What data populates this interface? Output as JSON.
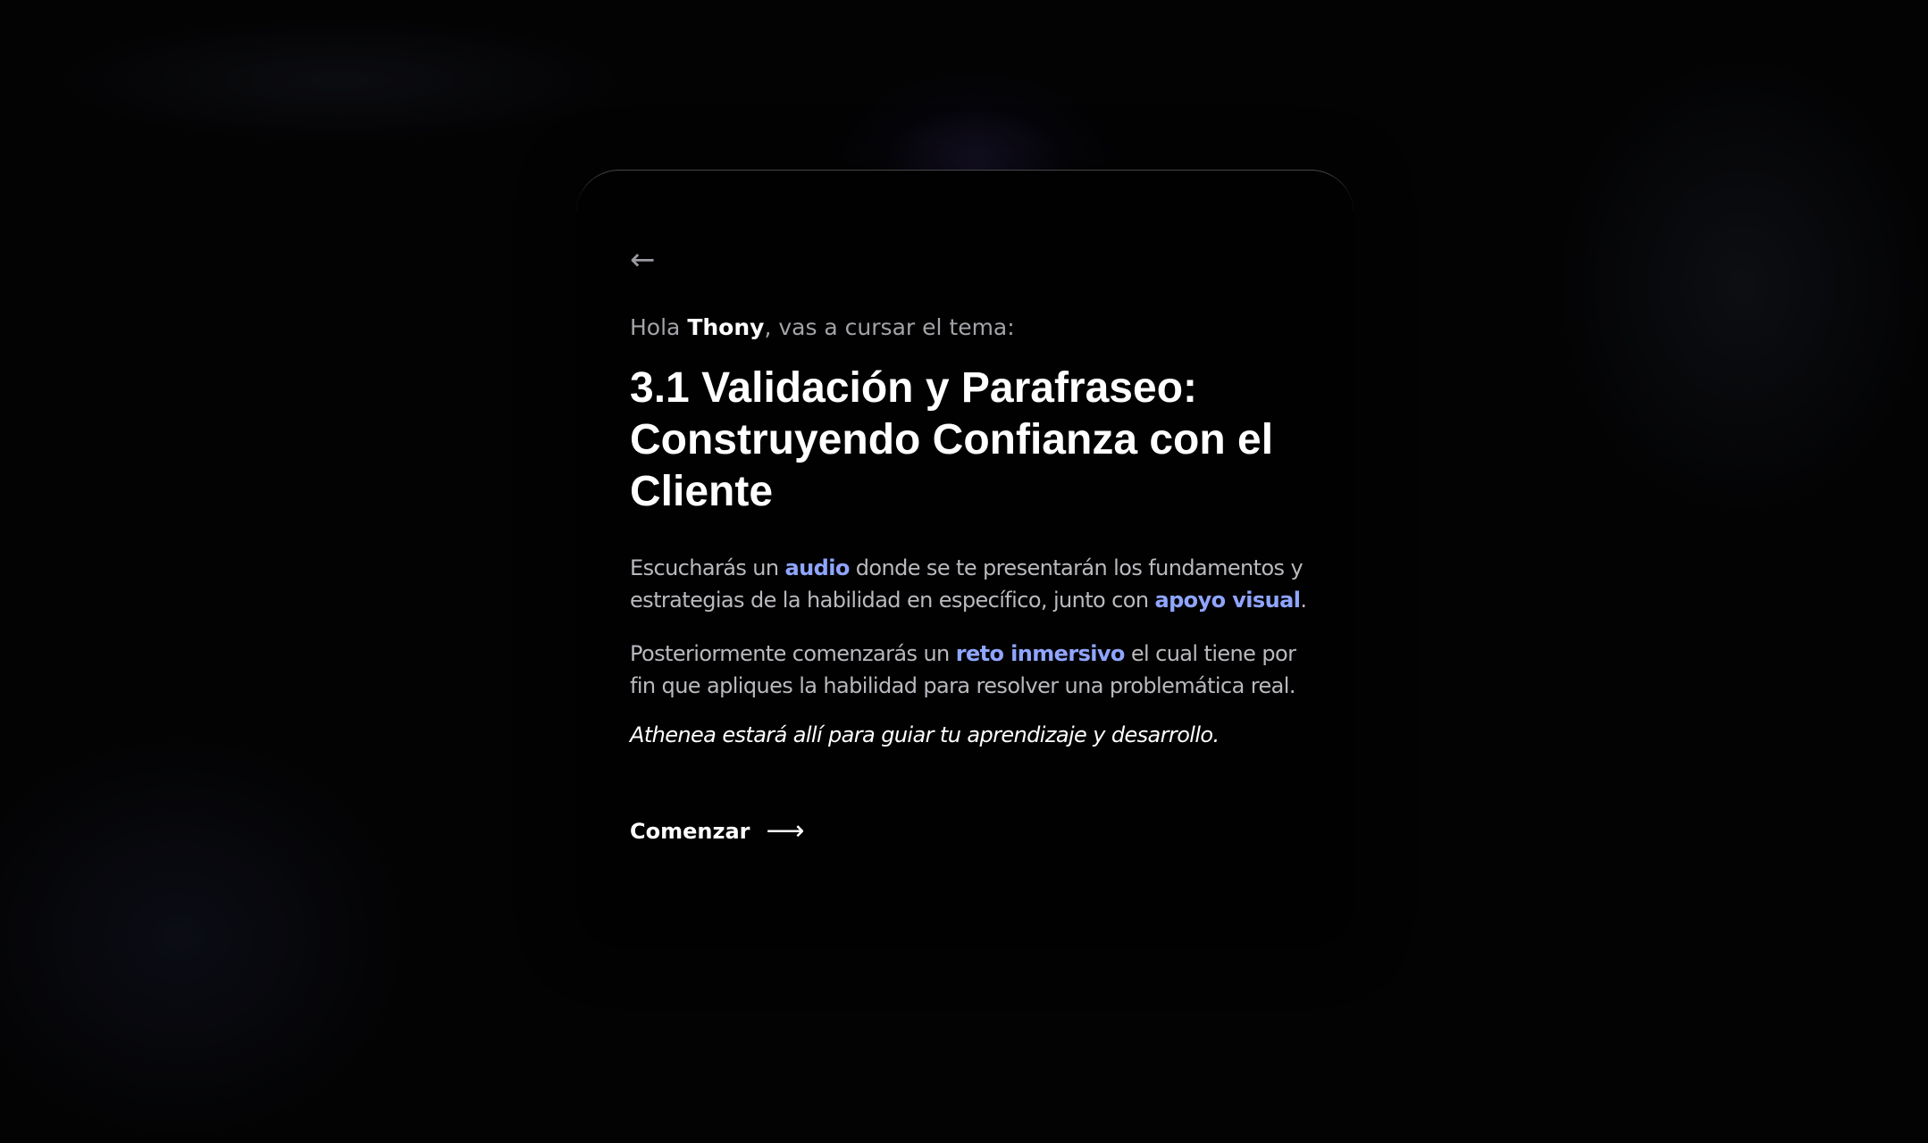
{
  "navigation": {
    "back_icon": "←",
    "back_icon_name": "arrow-left-icon"
  },
  "greeting": {
    "prefix": "Hola ",
    "name": "Thony",
    "suffix": ", vas a cursar el tema:"
  },
  "topic": {
    "title": "3.1 Validación y Parafraseo: Construyendo Confianza con el Cliente"
  },
  "description": {
    "p1_a": "Escucharás un ",
    "p1_highlight_1": "audio",
    "p1_b": " donde se te presentarán los fundamentos y estrategias de la habilidad en específico, junto con ",
    "p1_highlight_2": "apoyo visual",
    "p1_c": ".",
    "p2_a": "Posteriormente comenzarás un ",
    "p2_highlight": "reto inmersivo",
    "p2_b": " el cual tiene por fin que apliques la habilidad para resolver una problemática real.",
    "note": "Athenea estará allí para guiar tu aprendizaje y desarrollo."
  },
  "actions": {
    "start_label": "Comenzar",
    "start_icon": "⟶",
    "start_icon_name": "arrow-right-icon"
  },
  "colors": {
    "background": "#030304",
    "card": "#010102",
    "highlight": "#8fa5ff",
    "muted_text": "#b9b9be"
  }
}
